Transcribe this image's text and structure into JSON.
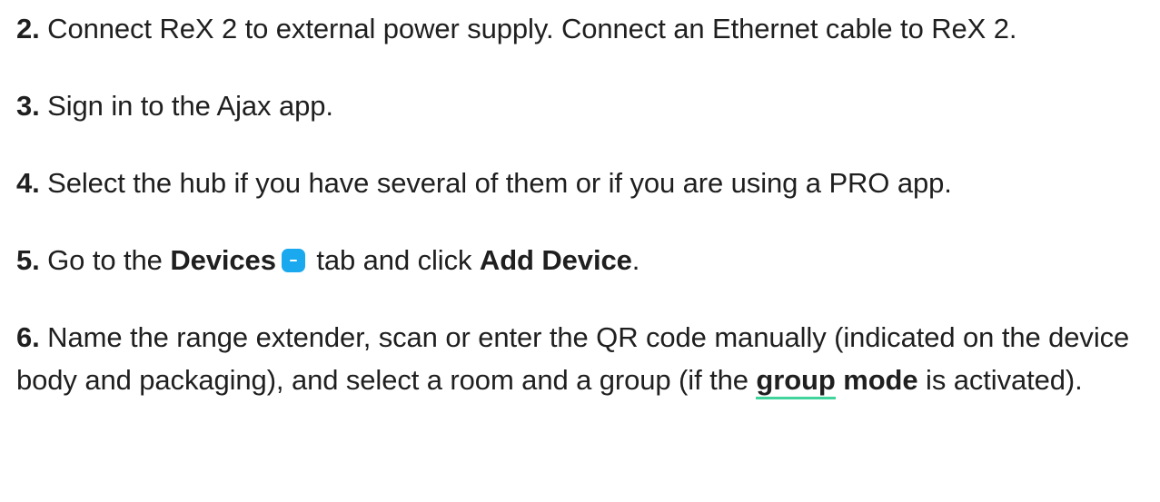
{
  "steps": [
    {
      "num": "2.",
      "text": "Connect ReX 2 to external power supply. Connect an Ethernet cable to ReX 2."
    },
    {
      "num": "3.",
      "text": "Sign in to the Ajax app."
    },
    {
      "num": "4.",
      "text": "Select the hub if you have several of them or if you are using a PRO app."
    },
    {
      "num": "5.",
      "pre": "Go to the",
      "devices": "Devices",
      "mid": "tab and click",
      "add_device": "Add Device",
      "end": ".",
      "icon": "devices-tab-icon",
      "icon_color": "#1aa8ee"
    },
    {
      "num": "6.",
      "pre": "Name the range extender, scan or enter the QR code manually (indicated on the device body and packaging), and select a room and a group (if the",
      "link_a": "group",
      "link_b": "mode",
      "end": "is activated).",
      "link_underline_color": "#40d39b"
    }
  ]
}
